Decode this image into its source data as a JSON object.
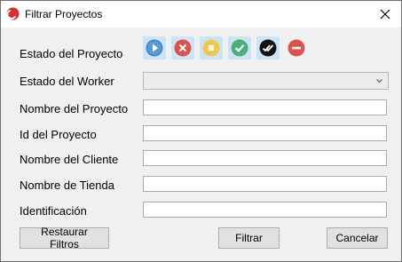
{
  "window": {
    "title": "Filtrar Proyectos"
  },
  "form": {
    "labels": {
      "estado_proyecto": "Estado del Proyecto",
      "estado_worker": "Estado del Worker",
      "nombre_proyecto": "Nombre del Proyecto",
      "id_proyecto": "Id del Proyecto",
      "nombre_cliente": "Nombre del Cliente",
      "nombre_tienda": "Nombre de Tienda",
      "identificacion": "Identificación"
    },
    "values": {
      "estado_worker": "",
      "nombre_proyecto": "",
      "id_proyecto": "",
      "nombre_cliente": "",
      "nombre_tienda": "",
      "identificacion": ""
    },
    "status_icons": [
      {
        "name": "play-icon",
        "color": "#3a86c8"
      },
      {
        "name": "cancel-x-icon",
        "color": "#d9534f"
      },
      {
        "name": "stop-square-icon",
        "color": "#e8c24a"
      },
      {
        "name": "check-icon",
        "color": "#4caf7a"
      },
      {
        "name": "double-check-icon",
        "color": "#111111"
      },
      {
        "name": "block-minus-icon",
        "color": "#d9534f"
      }
    ]
  },
  "buttons": {
    "restaurar": "Restaurar Filtros",
    "filtrar": "Filtrar",
    "cancelar": "Cancelar"
  }
}
